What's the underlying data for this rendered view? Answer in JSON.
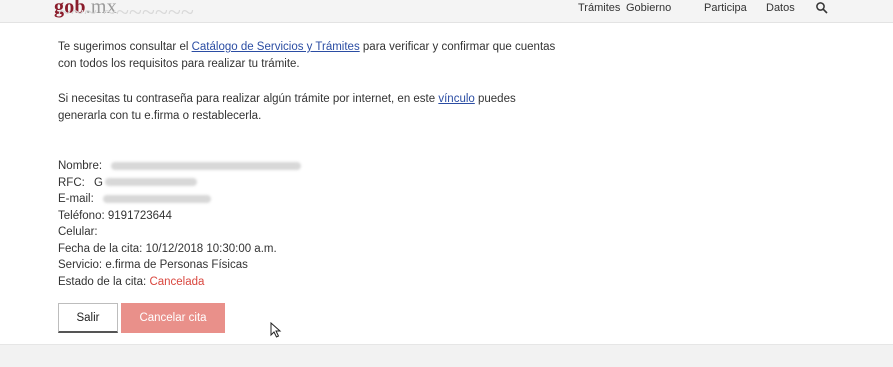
{
  "header": {
    "logo_main": "gob",
    "logo_suffix": ".mx",
    "nav": [
      "Trámites",
      "Gobierno",
      "Participa",
      "Datos"
    ]
  },
  "page": {
    "heading_ghost": "~~~ ~~~~~~~",
    "para1_before": "Te sugerimos consultar el ",
    "para1_link": "Catálogo de Servicios y Trámites",
    "para1_after": " para verificar y confirmar que cuentas con todos los requisitos para realizar tu trámite.",
    "para2_before": "Si necesitas tu contraseña para realizar algún trámite por internet, en este ",
    "para2_link": "vínculo",
    "para2_after": " puedes generarla con tu e.firma o restablecerla."
  },
  "fields": {
    "nombre_label": "Nombre:",
    "rfc_label": "RFC:",
    "rfc_visible_prefix": "G",
    "email_label": "E-mail:",
    "telefono_label": "Teléfono:",
    "telefono_value": "9191723644",
    "celular_label": "Celular:",
    "fecha_label": "Fecha de la cita:",
    "fecha_value": "10/12/2018 10:30:00 a.m.",
    "servicio_label": "Servicio:",
    "servicio_value": "e.firma de Personas Físicas",
    "estado_label": "Estado de la cita:",
    "estado_value": "Cancelada"
  },
  "buttons": {
    "salir": "Salir",
    "cancelar": "Cancelar cita"
  },
  "colors": {
    "brand": "#8a1c2b",
    "link": "#2b4da3",
    "status_cancelled": "#d9463e",
    "cancel_button": "#e9908a"
  },
  "icons": [
    "search-icon",
    "mouse-cursor-icon"
  ]
}
